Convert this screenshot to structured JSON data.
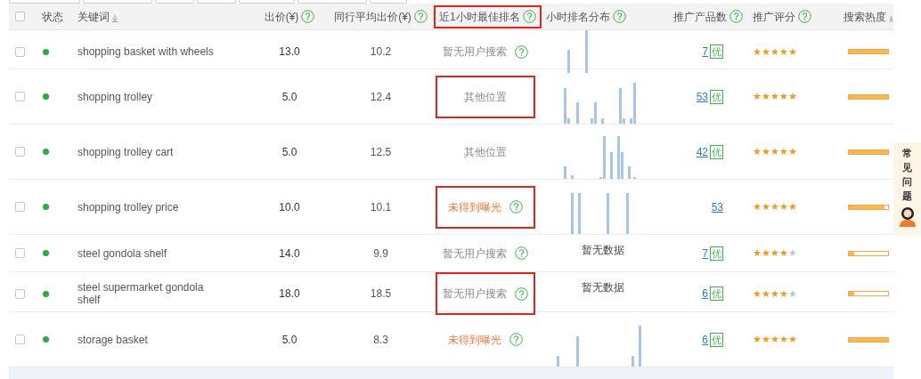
{
  "table": {
    "columns": [
      {
        "kind": "checkbox",
        "checked": false
      },
      {
        "kind": "text",
        "label": "状态"
      },
      {
        "kind": "sort",
        "label": "关键词"
      },
      {
        "kind": "help",
        "label": "出价(¥)"
      },
      {
        "kind": "help",
        "label": "同行平均出价(¥)"
      },
      {
        "kind": "help",
        "label": "近1小时最佳排名",
        "highlighted": true
      },
      {
        "kind": "help",
        "label": "小时排名分布"
      },
      {
        "kind": "help",
        "label": "推广产品数"
      },
      {
        "kind": "help",
        "label": "推广评分"
      },
      {
        "kind": "sort",
        "label": "搜索热度"
      }
    ],
    "rows": [
      {
        "checked": false,
        "color": "#2eab3f",
        "keyword": "shopping basket with wheels",
        "bid": "13.0",
        "avg_bid": "10.2",
        "rank": {
          "text": "暂无用户搜索",
          "kind": "muted",
          "help": true,
          "highlighted": false
        },
        "distribution": {
          "kind": "bars"
        },
        "products": {
          "text": "7",
          "badge": "优"
        },
        "stars": 5,
        "heat": {
          "level": 1.0
        }
      },
      {
        "checked": false,
        "color": "#2eab3f",
        "keyword": "shopping trolley",
        "bid": "5.0",
        "avg_bid": "12.4",
        "rank": {
          "text": "其他位置",
          "kind": "muted",
          "help": false,
          "highlighted": true
        },
        "distribution": {
          "kind": "bars"
        },
        "products": {
          "text": "53",
          "badge": "优"
        },
        "stars": 5,
        "heat": {
          "level": 1.0
        }
      },
      {
        "checked": false,
        "color": "#2eab3f",
        "keyword": "shopping trolley cart",
        "bid": "5.0",
        "avg_bid": "12.5",
        "rank": {
          "text": "其他位置",
          "kind": "muted",
          "help": false,
          "highlighted": false
        },
        "distribution": {
          "kind": "bars"
        },
        "products": {
          "text": "42",
          "badge": "优"
        },
        "stars": 5,
        "heat": {
          "level": 1.0
        }
      },
      {
        "checked": false,
        "color": "#2eab3f",
        "keyword": "shopping trolley price",
        "bid": "10.0",
        "avg_bid": "10.1",
        "rank": {
          "text": "未得到曝光",
          "kind": "warning",
          "help": true,
          "highlighted": true
        },
        "distribution": {
          "kind": "bars"
        },
        "products": {
          "text": "53"
        },
        "stars": 5,
        "heat": {
          "level": 0.9
        }
      },
      {
        "checked": false,
        "color": "#2eab3f",
        "keyword": "steel gondola shelf",
        "bid": "14.0",
        "avg_bid": "9.9",
        "rank": {
          "text": "暂无用户搜索",
          "kind": "muted",
          "help": true,
          "highlighted": false
        },
        "distribution": {
          "kind": "text",
          "text": "暂无数据"
        },
        "products": {
          "text": "7",
          "badge": "优"
        },
        "stars": 4,
        "heat": {
          "level": 0.13
        }
      },
      {
        "checked": false,
        "color": "#2eab3f",
        "keyword": "steel supermarket gondola shelf",
        "bid": "18.0",
        "avg_bid": "18.5",
        "rank": {
          "text": "暂无用户搜索",
          "kind": "muted",
          "help": true,
          "highlighted": true
        },
        "distribution": {
          "kind": "text",
          "text": "暂无数据"
        },
        "products": {
          "text": "6",
          "badge": "优"
        },
        "stars": 4,
        "heat": {
          "level": 0.13
        }
      },
      {
        "checked": false,
        "color": "#2eab3f",
        "keyword": "storage basket",
        "bid": "5.0",
        "avg_bid": "8.3",
        "rank": {
          "text": "未得到曝光",
          "kind": "warning",
          "help": true,
          "highlighted": false
        },
        "distribution": {
          "kind": "bars"
        },
        "products": {
          "text": "6",
          "badge": "优"
        },
        "stars": 5,
        "heat": {
          "level": 1.0
        }
      }
    ]
  },
  "side_widget": {
    "label": "常见问题"
  }
}
